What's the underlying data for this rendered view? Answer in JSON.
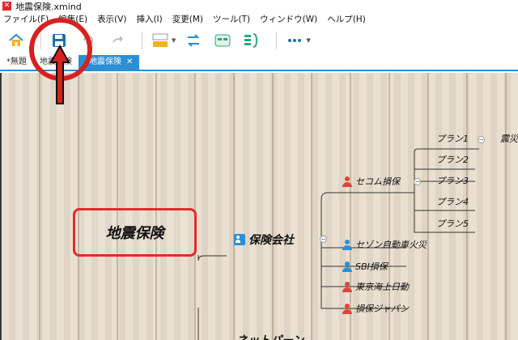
{
  "window": {
    "title": "地震保険.xmind",
    "app_icon": "xmind-icon"
  },
  "menu": [
    "ファイル(F)",
    "編集(E)",
    "表示(V)",
    "挿入(I)",
    "変更(M)",
    "ツール(T)",
    "ウィンドウ(W)",
    "ヘルプ(H)"
  ],
  "toolbar": {
    "icons": [
      "home-icon",
      "save-icon",
      "undo-icon",
      "redo-icon",
      "topic-style-icon",
      "relationship-icon",
      "boundary-icon",
      "summary-icon",
      "more-icon"
    ]
  },
  "tabs": [
    {
      "label": "*無題"
    },
    {
      "label": "地震保険"
    },
    {
      "label": "*地震保険",
      "active": true,
      "close": "✕"
    }
  ],
  "mindmap": {
    "root": "地震保険",
    "mid": "保険会社",
    "companies": [
      "セコム損保",
      "セゾン自動車火災",
      "SBI損保",
      "東京海上日動",
      "損保ジャパン"
    ],
    "plans": [
      "プラン1",
      "プラン2",
      "プラン3",
      "プラン4",
      "プラン5"
    ],
    "plan1_child": "震災",
    "partial_bottom": "ネットパーン",
    "collapse_symbol": "−"
  },
  "annotation": {
    "color": "#d82020"
  },
  "colors": {
    "accent": "#2a8fd6",
    "root_border": "#e52a2a"
  }
}
